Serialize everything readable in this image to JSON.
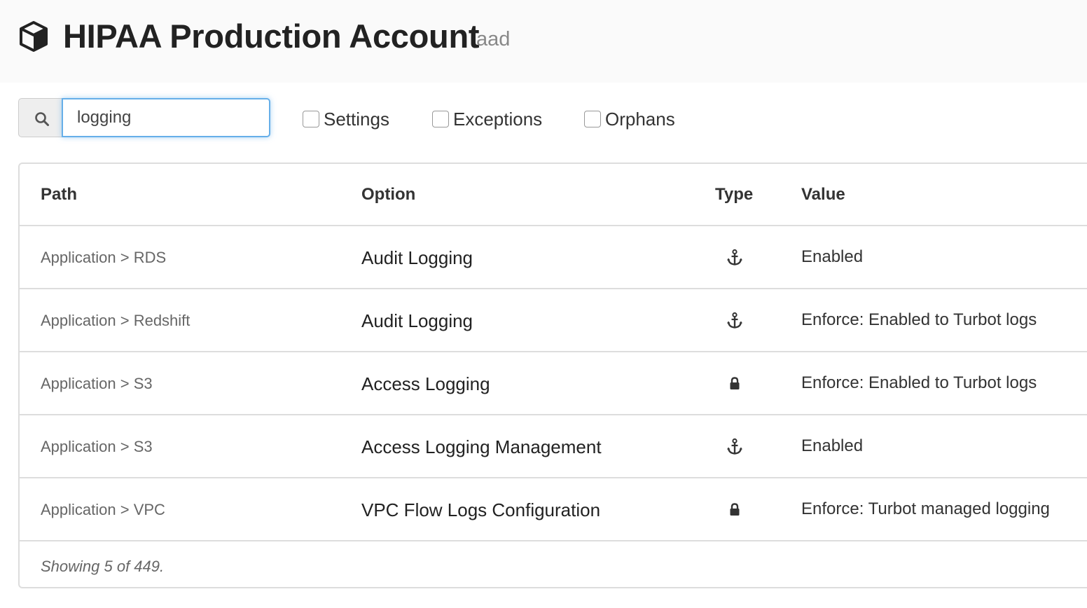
{
  "header": {
    "title": "HIPAA Production Account",
    "subtitle": "aad",
    "icon": "cube-icon"
  },
  "search": {
    "value": "logging",
    "icon": "search-icon"
  },
  "filters": [
    {
      "label": "Settings",
      "checked": false
    },
    {
      "label": "Exceptions",
      "checked": false
    },
    {
      "label": "Orphans",
      "checked": false
    }
  ],
  "table": {
    "columns": [
      "Path",
      "Option",
      "Type",
      "Value"
    ],
    "rows": [
      {
        "path": "Application > RDS",
        "option": "Audit Logging",
        "type_icon": "anchor-icon",
        "value": "Enabled"
      },
      {
        "path": "Application > Redshift",
        "option": "Audit Logging",
        "type_icon": "anchor-icon",
        "value": "Enforce: Enabled to Turbot logs"
      },
      {
        "path": "Application > S3",
        "option": "Access Logging",
        "type_icon": "lock-icon",
        "value": "Enforce: Enabled to Turbot logs"
      },
      {
        "path": "Application > S3",
        "option": "Access Logging Management",
        "type_icon": "anchor-icon",
        "value": "Enabled"
      },
      {
        "path": "Application > VPC",
        "option": "VPC Flow Logs Configuration",
        "type_icon": "lock-icon",
        "value": "Enforce: Turbot managed logging"
      }
    ],
    "footer": "Showing 5 of 449."
  },
  "colors": {
    "focus_border": "#66afe9",
    "header_bg": "#fafafa",
    "border": "#dddddd"
  }
}
